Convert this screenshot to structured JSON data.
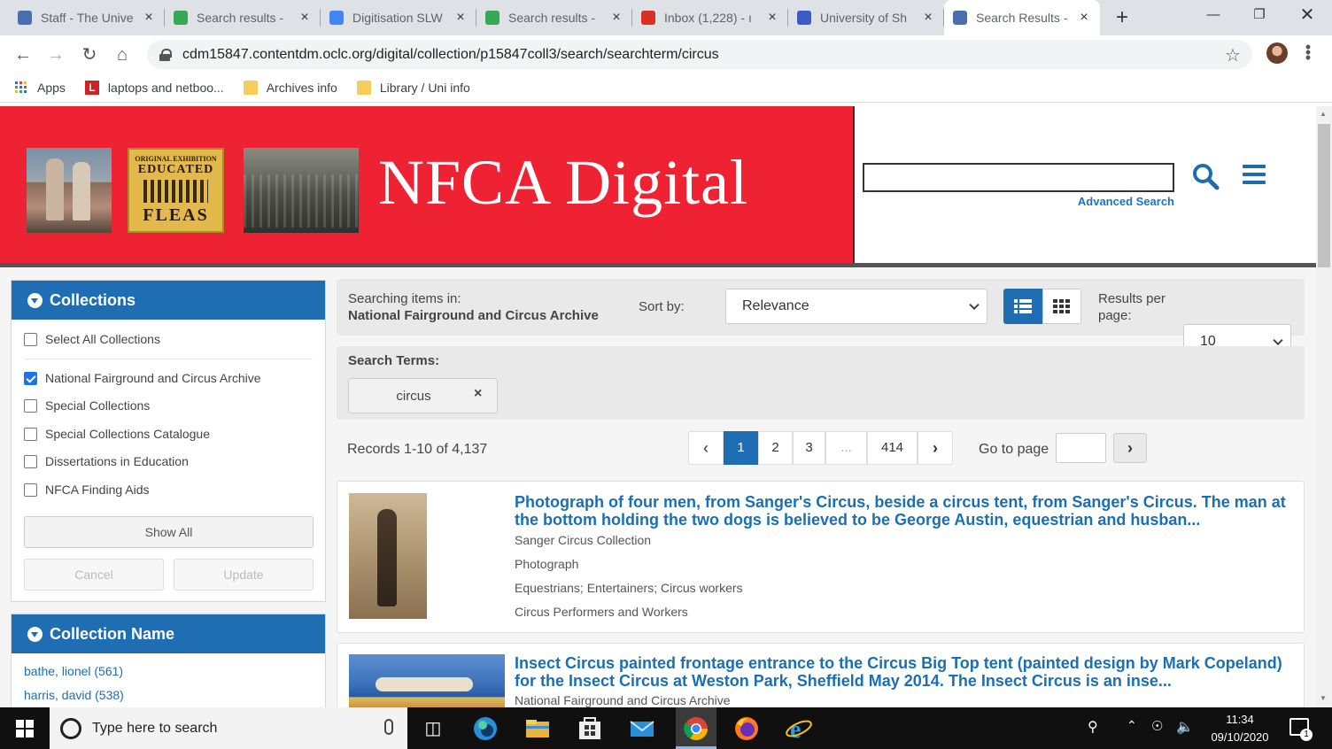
{
  "browser": {
    "tabs": [
      {
        "title": "Staff - The Unive",
        "icon": "shield-icon",
        "color": "#4a6fb0"
      },
      {
        "title": "Search results -",
        "icon": "google-drive-icon",
        "color": "#34a853"
      },
      {
        "title": "Digitisation SLW",
        "icon": "google-docs-icon",
        "color": "#4285f4"
      },
      {
        "title": "Search results -",
        "icon": "google-drive-icon",
        "color": "#34a853"
      },
      {
        "title": "Inbox (1,228) - ı",
        "icon": "gmail-icon",
        "color": "#d93025"
      },
      {
        "title": "University of Sh",
        "icon": "calendar-icon",
        "color": "#3b5cc4"
      },
      {
        "title": "Search Results -",
        "icon": "shield-icon",
        "color": "#4a6fb0",
        "active": true
      }
    ],
    "url": "cdm15847.contentdm.oclc.org/digital/collection/p15847coll3/search/searchterm/circus",
    "bookmarks": [
      {
        "label": "Apps",
        "icon": "apps-grid-icon"
      },
      {
        "label": "laptops and netboo...",
        "icon": "l-logo-icon"
      },
      {
        "label": "Archives info",
        "icon": "folder-icon"
      },
      {
        "label": "Library / Uni info",
        "icon": "folder-icon"
      }
    ]
  },
  "site": {
    "title": "NFCA Digital",
    "advanced_search": "Advanced Search",
    "search_value": "",
    "brand_red": "#ee2233",
    "brand_blue": "#1f6eb3"
  },
  "sidebar": {
    "collections": {
      "heading": "Collections",
      "select_all": "Select All Collections",
      "items": [
        {
          "label": "National Fairground and Circus Archive",
          "checked": true
        },
        {
          "label": "Special Collections",
          "checked": false
        },
        {
          "label": "Special Collections Catalogue",
          "checked": false
        },
        {
          "label": "Dissertations in Education",
          "checked": false
        },
        {
          "label": "NFCA Finding Aids",
          "checked": false
        }
      ],
      "show_all": "Show All",
      "cancel": "Cancel",
      "update": "Update"
    },
    "collection_name": {
      "heading": "Collection Name",
      "items": [
        "bathe, lionel (561)",
        "harris, david (538)"
      ]
    }
  },
  "main": {
    "searching_in_label": "Searching items in:",
    "searching_in_value": "National Fairground and Circus Archive",
    "sort_label": "Sort by:",
    "sort_value": "Relevance",
    "rpp_label": "Results per page:",
    "rpp_value": "10",
    "search_terms_label": "Search Terms:",
    "search_term": "circus",
    "records": "Records 1-10 of 4,137",
    "pages": [
      "1",
      "2",
      "3",
      "...",
      "414"
    ],
    "current_page": "1",
    "goto_label": "Go to page",
    "results": [
      {
        "title": "Photograph of four men, from Sanger's Circus, beside a circus tent, from Sanger's Circus. The man at the bottom holding the two dogs is believed to be George Austin, equestrian and husban...",
        "meta": [
          "Sanger Circus Collection",
          "Photograph",
          "Equestrians; Entertainers; Circus workers",
          "Circus Performers and Workers"
        ]
      },
      {
        "title": "Insect Circus painted frontage entrance to the Circus Big Top tent (painted design by Mark Copeland) for the Insect Circus at Weston Park, Sheffield May 2014. The Insect Circus is an inse...",
        "meta": [
          "National Fairground and Circus Archive"
        ]
      }
    ]
  },
  "taskbar": {
    "search_placeholder": "Type here to search",
    "time": "11:34",
    "date": "09/10/2020",
    "notifications": "1"
  }
}
